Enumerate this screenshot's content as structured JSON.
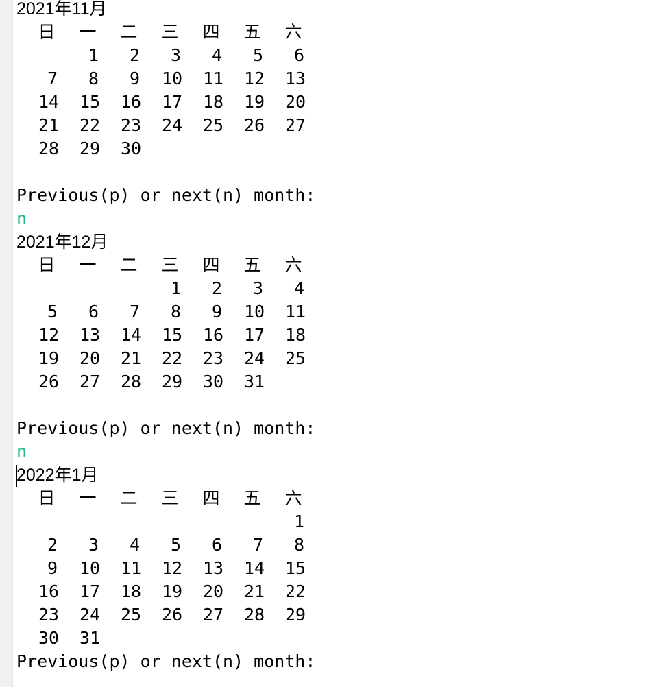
{
  "weekdays": [
    "日",
    "一",
    "二",
    "三",
    "四",
    "五",
    "六"
  ],
  "months": [
    {
      "title": "2021年11月",
      "weeks": [
        [
          "",
          "",
          "1",
          "2",
          "3",
          "4",
          "5",
          "6"
        ],
        [
          "7",
          "8",
          "9",
          "10",
          "11",
          "12",
          "13"
        ],
        [
          "14",
          "15",
          "16",
          "17",
          "18",
          "19",
          "20"
        ],
        [
          "21",
          "22",
          "23",
          "24",
          "25",
          "26",
          "27"
        ],
        [
          "28",
          "29",
          "30"
        ]
      ]
    },
    {
      "title": "2021年12月",
      "weeks": [
        [
          "",
          "",
          "",
          "1",
          "2",
          "3",
          "4"
        ],
        [
          "5",
          "6",
          "7",
          "8",
          "9",
          "10",
          "11"
        ],
        [
          "12",
          "13",
          "14",
          "15",
          "16",
          "17",
          "18"
        ],
        [
          "19",
          "20",
          "21",
          "22",
          "23",
          "24",
          "25"
        ],
        [
          "26",
          "27",
          "28",
          "29",
          "30",
          "31"
        ]
      ]
    },
    {
      "title": "2022年1月",
      "weeks": [
        [
          "",
          "",
          "",
          "",
          "",
          "",
          "1"
        ],
        [
          "2",
          "3",
          "4",
          "5",
          "6",
          "7",
          "8"
        ],
        [
          "9",
          "10",
          "11",
          "12",
          "13",
          "14",
          "15"
        ],
        [
          "16",
          "17",
          "18",
          "19",
          "20",
          "21",
          "22"
        ],
        [
          "23",
          "24",
          "25",
          "26",
          "27",
          "28",
          "29"
        ],
        [
          "30",
          "31"
        ]
      ]
    }
  ],
  "prompts": [
    "Previous(p) or next(n) month:",
    "Previous(p) or next(n) month:",
    "Previous(p) or next(n) month:"
  ],
  "inputs": [
    "n",
    "n"
  ],
  "colors": {
    "input_text": "#1cb886",
    "text": "#000000",
    "gutter": "#f0f0f0"
  }
}
